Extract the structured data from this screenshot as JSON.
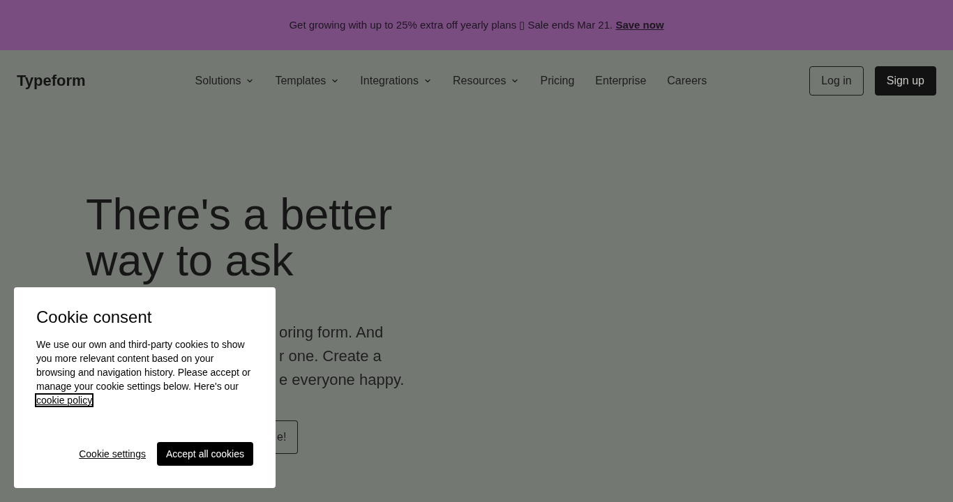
{
  "promo_banner": {
    "text": "Get growing with up to 25% extra off yearly plans ▯ Sale ends Mar 21.",
    "link": "Save now"
  },
  "navbar": {
    "logo": "Typeform",
    "items": [
      {
        "label": "Solutions",
        "kind": "dropdown"
      },
      {
        "label": "Templates",
        "kind": "dropdown"
      },
      {
        "label": "Integrations",
        "kind": "dropdown"
      },
      {
        "label": "Resources",
        "kind": "dropdown"
      },
      {
        "label": "Pricing",
        "kind": "link"
      },
      {
        "label": "Enterprise",
        "kind": "link"
      },
      {
        "label": "Careers",
        "kind": "link"
      }
    ],
    "actions": [
      {
        "label": "Log in",
        "kind": "outline"
      },
      {
        "label": "Sign up",
        "kind": "solid"
      }
    ]
  },
  "hero": {
    "heading": "There's a better way to ask",
    "subtitle_lines": [
      "oring form. And",
      "r one. Create a",
      "e everyone happy."
    ],
    "button": "e!"
  },
  "cookie_dialog": {
    "title": "Cookie consent",
    "text": "We use our own and third-party cookies to show you more relevant content based on your browsing and navigation history. Please accept or manage your cookie settings below. Here's our",
    "link": {
      "text": "cookie policy",
      "focused": true
    },
    "buttons": [
      {
        "label": "Cookie settings",
        "kind": "link"
      },
      {
        "label": "Accept all cookies",
        "kind": "primary"
      }
    ]
  }
}
